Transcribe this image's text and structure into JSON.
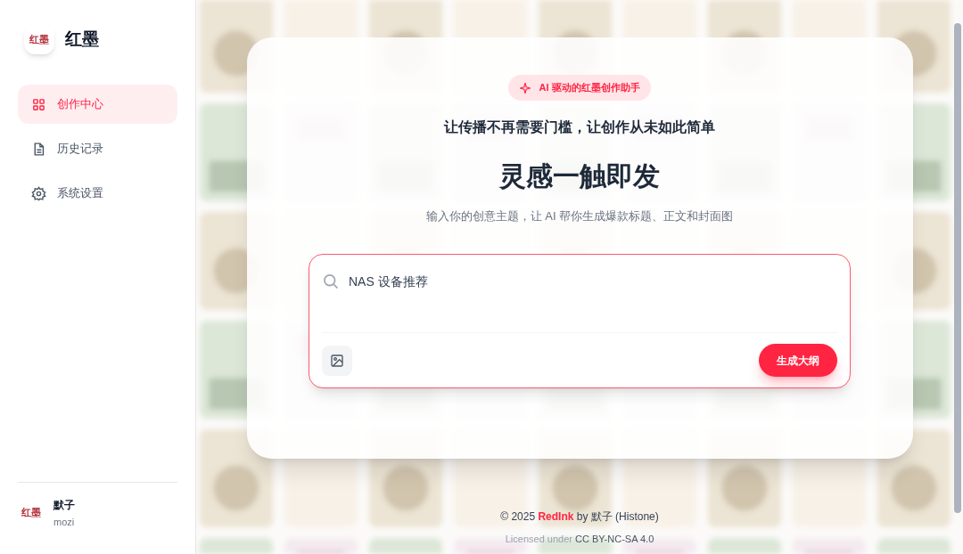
{
  "sidebar": {
    "logo_text": "红墨",
    "app_name": "红墨",
    "items": [
      {
        "label": "创作中心",
        "kind": "grid",
        "selected": true
      },
      {
        "label": "历史记录",
        "kind": "document",
        "selected": false
      },
      {
        "label": "系统设置",
        "kind": "gear",
        "selected": false
      }
    ],
    "user": {
      "avatar_text": "红墨",
      "name": "默子",
      "handle": "mozi"
    }
  },
  "hero": {
    "badge": "AI 驱动的红墨创作助手",
    "tagline": "让传播不再需要门槛，让创作从未如此简单",
    "title": "灵感一触即发",
    "subtitle": "输入你的创意主题，让 AI 帮你生成爆款标题、正文和封面图"
  },
  "composer": {
    "value": "NAS 设备推荐",
    "submit": "生成大纲"
  },
  "footer": {
    "copyright_prefix": "© 2025",
    "brand": "RedInk",
    "copyright_suffix": "by 默子 (Histone)",
    "license_prefix": "Licensed under",
    "license": "CC BY-NC-SA 4.0"
  }
}
